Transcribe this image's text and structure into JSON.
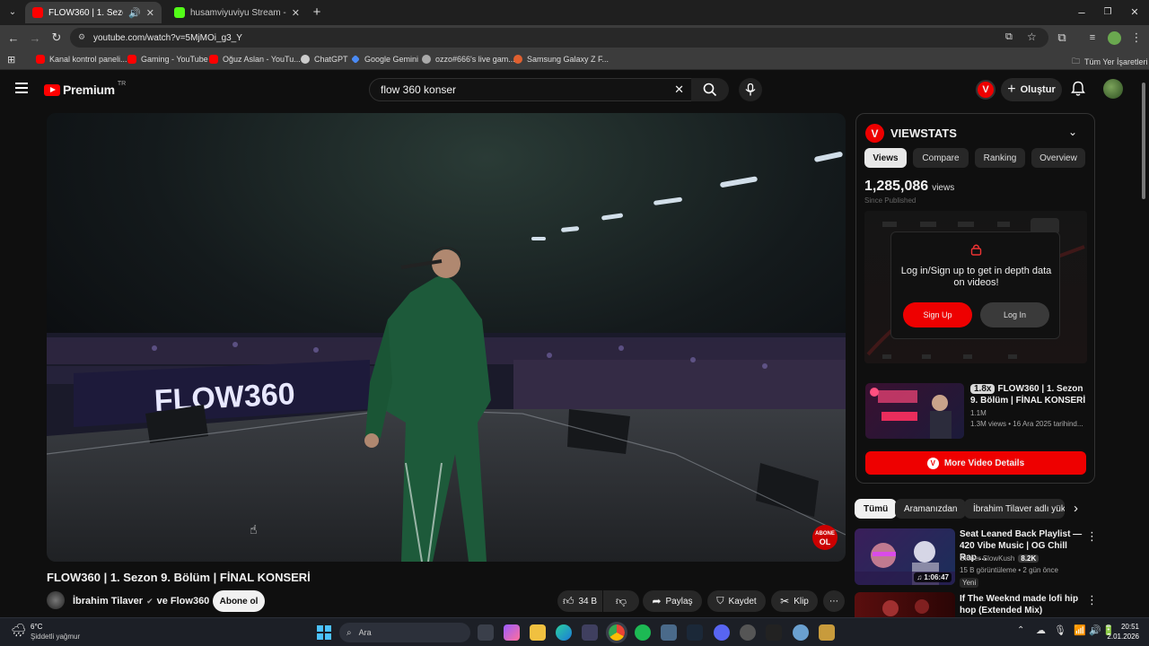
{
  "browser": {
    "tabs": [
      {
        "title": "FLOW360 | 1. Sezon 9. Bölüm",
        "color": "#ff0000"
      },
      {
        "title": "husamviyuviyu Stream - Watch",
        "color": "#53fc18"
      }
    ],
    "url": "youtube.com/watch?v=5MjMOi_g3_Y",
    "bookmarks": [
      "Kanal kontrol paneli...",
      "Gaming - YouTube",
      "Oğuz Aslan - YouTu...",
      "ChatGPT",
      "Google Gemini",
      "ozzo#666's live gam...",
      "Samsung Galaxy Z F..."
    ],
    "all_bookmarks": "Tüm Yer İşaretleri"
  },
  "youtube": {
    "logo_text": "Premium",
    "logo_badge": "TR",
    "search_value": "flow 360 konser",
    "create_label": "Oluştur"
  },
  "video": {
    "title": "FLOW360 | 1. Sezon 9. Bölüm | FİNAL KONSERİ",
    "channel": "İbrahim Tilaver",
    "channel_suffix": "ve Flow360",
    "subscribe_label": "Abone ol",
    "likes": "34 B",
    "share_label": "Paylaş",
    "save_label": "Kaydet",
    "clip_label": "Klip",
    "stage_banner": "FLOW360",
    "watermark_top": "ABONE",
    "watermark_bottom": "OL"
  },
  "viewstats": {
    "name": "VIEWSTATS",
    "tabs": [
      "Views",
      "Compare",
      "Ranking",
      "Overview"
    ],
    "views_number": "1,285,086",
    "views_unit": "views",
    "since": "Since Published",
    "login_text": "Log in/Sign up to get in depth data on videos!",
    "signup_label": "Sign Up",
    "login_label": "Log In",
    "speed_badge": "1.8x",
    "related_title": "FLOW360 | 1. Sezon 9. Bölüm | FİNAL KONSERİ",
    "related_stat": "1.1M",
    "related_meta": "1.3M views • 16 Ara 2025 tarihind...",
    "more_label": "More Video Details"
  },
  "chips": [
    "Tümü",
    "Aramanızdan",
    "İbrahim Tilaver adlı yükl"
  ],
  "recommended": [
    {
      "title": "Seat Leaned Back Playlist — 420 Vibe Music | OG Chill Rap ...",
      "channel": "Stoner SlowKush",
      "badge": "8.2K",
      "meta": "15 B görüntüleme • 2 gün önce",
      "tag": "Yeni",
      "duration": "1:06:47"
    },
    {
      "title": "If The Weeknd made lofi hip hop (Extended Mix)"
    }
  ],
  "taskbar": {
    "temp": "6°C",
    "weather": "Şiddetli yağmur",
    "search_placeholder": "Ara",
    "time": "20:51",
    "date": "2.01.2026"
  },
  "colors": {
    "accent": "#ff0000",
    "viewstats_red": "#ee0000"
  }
}
